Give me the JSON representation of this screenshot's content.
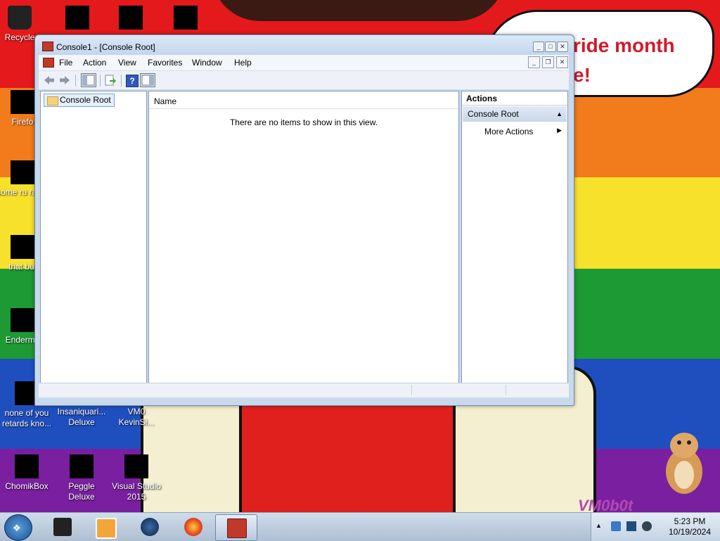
{
  "window": {
    "title": "Console1 - [Console Root]",
    "controls": {
      "minimize": "_",
      "maximize": "□",
      "close": "✕"
    },
    "mdi_controls": {
      "minimize": "_",
      "restore": "❐",
      "close": "✕"
    }
  },
  "menubar": {
    "items": [
      "File",
      "Action",
      "View",
      "Favorites",
      "Window",
      "Help"
    ]
  },
  "toolbar": {
    "icons": [
      "back-icon",
      "forward-icon",
      "show-hide-console-tree-icon",
      "export-list-icon",
      "help-icon",
      "show-hide-action-pane-icon"
    ],
    "help_glyph": "?"
  },
  "tree": {
    "root_label": "Console Root"
  },
  "list_view": {
    "column_header": "Name",
    "empty_message": "There are no items to show in this view."
  },
  "actions_pane": {
    "title": "Actions",
    "section": "Console Root",
    "items": [
      "More Actions"
    ]
  },
  "desktop": {
    "speech_text_line1": "ride month",
    "speech_text_line2": "e!",
    "watermark": "VM0b0t",
    "icons": [
      {
        "label": "Recycle"
      },
      {
        "label": "Firefo"
      },
      {
        "label": "some ru ran a"
      },
      {
        "label": "that but"
      },
      {
        "label": "Enderma"
      },
      {
        "label": "none of you retards kno..."
      },
      {
        "label": "Insaniquari... Deluxe"
      },
      {
        "label": "VM0 KevinSi..."
      },
      {
        "label": "ChomikBox"
      },
      {
        "label": "Peggle Deluxe"
      },
      {
        "label": "Visual Studio 2015"
      }
    ]
  },
  "taskbar": {
    "start_glyph": "❖",
    "pinned": [
      "file-manager-icon",
      "media-player-icon",
      "steam-icon",
      "firefox-icon",
      "mmc-console-icon"
    ],
    "time": "5:23 PM",
    "date": "10/19/2024",
    "tray_arrow": "▲"
  },
  "colors": {
    "window_frame": "#c9d9ec",
    "actions_section": "#c8d7e9",
    "taskbar": "#aebfd3",
    "rainbow": [
      "#e3191c",
      "#f27b1b",
      "#f7e12b",
      "#1e9a34",
      "#1f4fbf",
      "#7a1fa0"
    ]
  }
}
